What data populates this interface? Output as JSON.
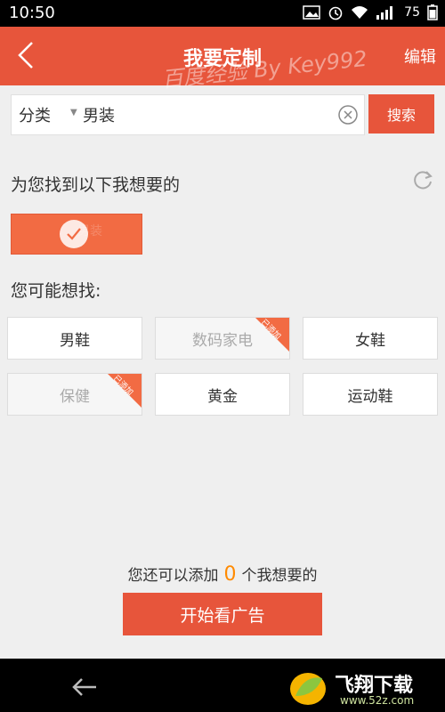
{
  "status_bar": {
    "time": "10:50",
    "battery": "75"
  },
  "app_bar": {
    "title": "我要定制",
    "edit_label": "编辑"
  },
  "search": {
    "category": "分类",
    "query": "男装",
    "button_label": "搜索"
  },
  "watermark": "百度经验 By Key992",
  "found_section": {
    "title": "为您找到以下我想要的",
    "selected_chip_label": "男装"
  },
  "suggest_section": {
    "title": "您可能想找:",
    "added_badge": "已添加",
    "items": [
      {
        "label": "男鞋",
        "added": false
      },
      {
        "label": "数码家电",
        "added": true
      },
      {
        "label": "女鞋",
        "added": false
      },
      {
        "label": "保健",
        "added": true
      },
      {
        "label": "黄金",
        "added": false
      },
      {
        "label": "运动鞋",
        "added": false
      }
    ]
  },
  "footer": {
    "prefix": "您还可以添加",
    "count": "0",
    "suffix": "个我想要的",
    "start_button": "开始看广告"
  },
  "nav_bar": {
    "logo_main": "飞翔下载",
    "logo_sub": "www.52z.com"
  },
  "colors": {
    "accent": "#e7553b",
    "chip": "#f26b43",
    "count": "#ff8a00"
  },
  "icons": [
    "back-arrow-icon",
    "clear-icon",
    "refresh-icon",
    "check-icon",
    "added-ribbon-icon",
    "nav-back-icon"
  ]
}
